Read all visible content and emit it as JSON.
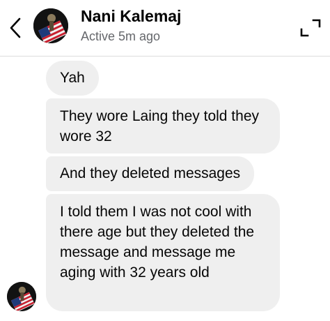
{
  "header": {
    "contact_name": "Nani Kalemaj",
    "status": "Active 5m ago",
    "back_icon": "chevron-left-icon",
    "expand_icon": "expand-corners-icon"
  },
  "messages": [
    {
      "sender": "contact",
      "text": "Yah"
    },
    {
      "sender": "contact",
      "text": "They wore Laing they told they wore 32"
    },
    {
      "sender": "contact",
      "text": "And they deleted messages"
    },
    {
      "sender": "contact",
      "text": "I told them I was not cool with there age but they deleted the message and message me aging with 32 years old"
    }
  ],
  "colors": {
    "bubble_background": "#efefef",
    "status_text": "#65676b"
  }
}
